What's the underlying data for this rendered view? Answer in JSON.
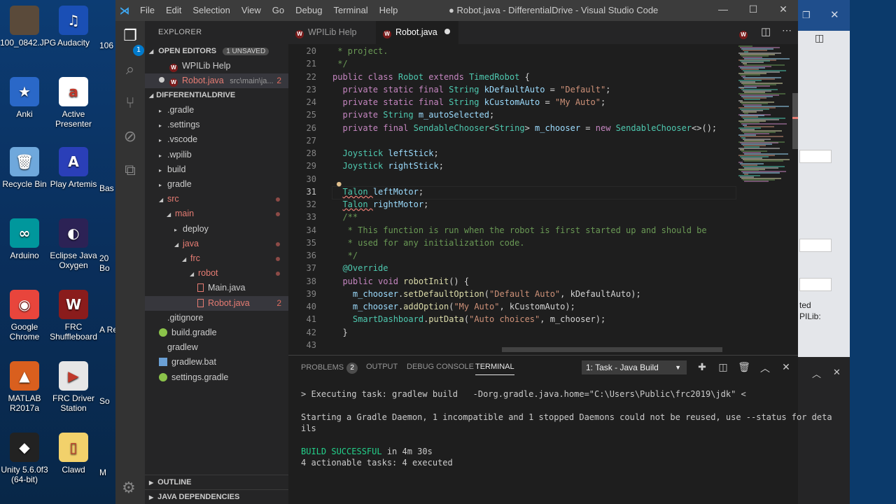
{
  "desktop": {
    "icons": [
      {
        "label": "100_0842.JPG",
        "color": "#5a4a3a",
        "glyph": ""
      },
      {
        "label": "Audacity",
        "color": "#1a4fb5",
        "glyph": "♫"
      },
      {
        "label": "Anki",
        "color": "#2a68c8",
        "glyph": "★"
      },
      {
        "label": "Active Presenter",
        "color": "#ffffff",
        "glyph": "a"
      },
      {
        "label": "Recycle Bin",
        "color": "#6fa8dc",
        "glyph": "🗑"
      },
      {
        "label": "Play Artemis",
        "color": "#2a3fb8",
        "glyph": "A"
      },
      {
        "label": "Arduino",
        "color": "#00979c",
        "glyph": "∞"
      },
      {
        "label": "Eclipse Java Oxygen",
        "color": "#2c2255",
        "glyph": "◐"
      },
      {
        "label": "Google Chrome",
        "color": "#e8453c",
        "glyph": "◉"
      },
      {
        "label": "FRC Shuffleboard",
        "color": "#8a1c1c",
        "glyph": "W"
      },
      {
        "label": "MATLAB R2017a",
        "color": "#d95f1e",
        "glyph": "▲"
      },
      {
        "label": "FRC Driver Station",
        "color": "#e6e6e6",
        "glyph": "▶"
      },
      {
        "label": "Unity 5.6.0f3 (64-bit)",
        "color": "#222222",
        "glyph": "◆"
      },
      {
        "label": "Clawd",
        "color": "#f2d16b",
        "glyph": "▯"
      }
    ],
    "partial_labels": [
      "106",
      "Bas",
      "20 Bo",
      "A Re",
      "So",
      "M"
    ]
  },
  "window": {
    "title": "● Robot.java - DifferentialDrive - Visual Studio Code",
    "menu": [
      "File",
      "Edit",
      "Selection",
      "View",
      "Go",
      "Debug",
      "Terminal",
      "Help"
    ]
  },
  "activity": {
    "scm_badge": "1",
    "icons": [
      "files-icon",
      "search-icon",
      "source-control-icon",
      "debug-icon",
      "extensions-icon"
    ]
  },
  "explorer": {
    "title": "EXPLORER",
    "open_editors_label": "OPEN EDITORS",
    "unsaved_badge": "1 UNSAVED",
    "open_editors": [
      {
        "name": "WPILib Help",
        "path": "",
        "count": ""
      },
      {
        "name": "Robot.java",
        "path": "src\\main\\ja...",
        "count": "2"
      }
    ],
    "project_label": "DIFFERENTIALDRIVE",
    "tree": [
      {
        "label": ".gradle",
        "depth": 0,
        "arrow": "▸",
        "kind": "folder",
        "red": false,
        "count": "",
        "dot": false
      },
      {
        "label": ".settings",
        "depth": 0,
        "arrow": "▸",
        "kind": "folder",
        "red": false,
        "count": "",
        "dot": false
      },
      {
        "label": ".vscode",
        "depth": 0,
        "arrow": "▸",
        "kind": "folder",
        "red": false,
        "count": "",
        "dot": false
      },
      {
        "label": ".wpilib",
        "depth": 0,
        "arrow": "▸",
        "kind": "folder",
        "red": false,
        "count": "",
        "dot": false
      },
      {
        "label": "build",
        "depth": 0,
        "arrow": "▸",
        "kind": "folder",
        "red": false,
        "count": "",
        "dot": false
      },
      {
        "label": "gradle",
        "depth": 0,
        "arrow": "▸",
        "kind": "folder",
        "red": false,
        "count": "",
        "dot": false
      },
      {
        "label": "src",
        "depth": 0,
        "arrow": "◢",
        "kind": "folder",
        "red": true,
        "count": "",
        "dot": true
      },
      {
        "label": "main",
        "depth": 1,
        "arrow": "◢",
        "kind": "folder",
        "red": true,
        "count": "",
        "dot": true
      },
      {
        "label": "deploy",
        "depth": 2,
        "arrow": "▸",
        "kind": "folder",
        "red": false,
        "count": "",
        "dot": false
      },
      {
        "label": "java",
        "depth": 2,
        "arrow": "◢",
        "kind": "folder",
        "red": true,
        "count": "",
        "dot": true
      },
      {
        "label": "frc",
        "depth": 3,
        "arrow": "◢",
        "kind": "folder",
        "red": true,
        "count": "",
        "dot": true
      },
      {
        "label": "robot",
        "depth": 4,
        "arrow": "◢",
        "kind": "folder",
        "red": true,
        "count": "",
        "dot": true
      },
      {
        "label": "Main.java",
        "depth": 5,
        "arrow": "",
        "kind": "java",
        "red": false,
        "count": "",
        "dot": false
      },
      {
        "label": "Robot.java",
        "depth": 5,
        "arrow": "",
        "kind": "java",
        "red": true,
        "count": "2",
        "dot": false
      },
      {
        "label": ".gitignore",
        "depth": 0,
        "arrow": "",
        "kind": "text",
        "red": false,
        "count": "",
        "dot": false
      },
      {
        "label": "build.gradle",
        "depth": 0,
        "arrow": "",
        "kind": "gradle",
        "red": false,
        "count": "",
        "dot": false
      },
      {
        "label": "gradlew",
        "depth": 0,
        "arrow": "",
        "kind": "text",
        "red": false,
        "count": "",
        "dot": false
      },
      {
        "label": "gradlew.bat",
        "depth": 0,
        "arrow": "",
        "kind": "bat",
        "red": false,
        "count": "",
        "dot": false
      },
      {
        "label": "settings.gradle",
        "depth": 0,
        "arrow": "",
        "kind": "gradle",
        "red": false,
        "count": "",
        "dot": false
      }
    ],
    "outline_label": "OUTLINE",
    "java_deps_label": "JAVA DEPENDENCIES"
  },
  "tabs": [
    {
      "label": "WPILib Help",
      "active": false
    },
    {
      "label": "Robot.java",
      "active": true
    }
  ],
  "editor": {
    "current_line": 31,
    "lines": [
      {
        "n": 20,
        "t": [
          [
            "cm",
            " * project."
          ]
        ]
      },
      {
        "n": 21,
        "t": [
          [
            "cm",
            " */"
          ]
        ]
      },
      {
        "n": 22,
        "t": [
          [
            "kw",
            "public class "
          ],
          [
            "ty",
            "Robot "
          ],
          [
            "kw",
            "extends "
          ],
          [
            "ty",
            "TimedRobot "
          ],
          [
            "",
            "{"
          ]
        ]
      },
      {
        "n": 23,
        "t": [
          [
            "",
            "  "
          ],
          [
            "kw",
            "private static final "
          ],
          [
            "ty",
            "String "
          ],
          [
            "vr",
            "kDefaultAuto"
          ],
          [
            "",
            " = "
          ],
          [
            "st",
            "\"Default\""
          ],
          [
            "",
            ";"
          ]
        ]
      },
      {
        "n": 24,
        "t": [
          [
            "",
            "  "
          ],
          [
            "kw",
            "private static final "
          ],
          [
            "ty",
            "String "
          ],
          [
            "vr",
            "kCustomAuto"
          ],
          [
            "",
            " = "
          ],
          [
            "st",
            "\"My Auto\""
          ],
          [
            "",
            ";"
          ]
        ]
      },
      {
        "n": 25,
        "t": [
          [
            "",
            "  "
          ],
          [
            "kw",
            "private "
          ],
          [
            "ty",
            "String "
          ],
          [
            "vr",
            "m_autoSelected"
          ],
          [
            "",
            ";"
          ]
        ]
      },
      {
        "n": 26,
        "t": [
          [
            "",
            "  "
          ],
          [
            "kw",
            "private final "
          ],
          [
            "ty",
            "SendableChooser"
          ],
          [
            "",
            "<"
          ],
          [
            "ty",
            "String"
          ],
          [
            "",
            "> "
          ],
          [
            "vr",
            "m_chooser"
          ],
          [
            "",
            " = "
          ],
          [
            "kw",
            "new "
          ],
          [
            "ty",
            "SendableChooser"
          ],
          [
            "",
            "<>();"
          ]
        ]
      },
      {
        "n": 27,
        "t": [
          [
            "",
            ""
          ]
        ]
      },
      {
        "n": 28,
        "t": [
          [
            "",
            "  "
          ],
          [
            "ty",
            "Joystick "
          ],
          [
            "vr",
            "leftStick"
          ],
          [
            "",
            ";"
          ]
        ]
      },
      {
        "n": 29,
        "t": [
          [
            "",
            "  "
          ],
          [
            "ty",
            "Joystick "
          ],
          [
            "vr",
            "rightStick"
          ],
          [
            "",
            ";"
          ]
        ]
      },
      {
        "n": 30,
        "t": [
          [
            "",
            ""
          ]
        ]
      },
      {
        "n": 31,
        "t": [
          [
            "",
            "  "
          ],
          [
            "ty",
            "Talon "
          ],
          [
            "vr",
            "leftMotor"
          ],
          [
            "",
            ";"
          ]
        ]
      },
      {
        "n": 32,
        "t": [
          [
            "",
            "  "
          ],
          [
            "ty",
            "Talon "
          ],
          [
            "vr",
            "rightMotor"
          ],
          [
            "",
            ";"
          ]
        ]
      },
      {
        "n": 33,
        "t": [
          [
            "",
            "  "
          ],
          [
            "cm",
            "/**"
          ]
        ]
      },
      {
        "n": 34,
        "t": [
          [
            "cm",
            "   * This function is run when the robot is first started up and should be"
          ]
        ]
      },
      {
        "n": 35,
        "t": [
          [
            "cm",
            "   * used for any initialization code."
          ]
        ]
      },
      {
        "n": 36,
        "t": [
          [
            "cm",
            "   */"
          ]
        ]
      },
      {
        "n": 37,
        "t": [
          [
            "",
            "  "
          ],
          [
            "an",
            "@Override"
          ]
        ]
      },
      {
        "n": 38,
        "t": [
          [
            "",
            "  "
          ],
          [
            "kw",
            "public void "
          ],
          [
            "fn",
            "robotInit"
          ],
          [
            "",
            "() {"
          ]
        ]
      },
      {
        "n": 39,
        "t": [
          [
            "",
            "    "
          ],
          [
            "vr",
            "m_chooser"
          ],
          [
            "",
            "."
          ],
          [
            "fn",
            "setDefaultOption"
          ],
          [
            "",
            "("
          ],
          [
            "st",
            "\"Default Auto\""
          ],
          [
            "",
            ", kDefaultAuto);"
          ]
        ]
      },
      {
        "n": 40,
        "t": [
          [
            "",
            "    "
          ],
          [
            "vr",
            "m_chooser"
          ],
          [
            "",
            "."
          ],
          [
            "fn",
            "addOption"
          ],
          [
            "",
            "("
          ],
          [
            "st",
            "\"My Auto\""
          ],
          [
            "",
            ", kCustomAuto);"
          ]
        ]
      },
      {
        "n": 41,
        "t": [
          [
            "",
            "    "
          ],
          [
            "ty",
            "SmartDashboard"
          ],
          [
            "",
            "."
          ],
          [
            "fn",
            "putData"
          ],
          [
            "",
            "("
          ],
          [
            "st",
            "\"Auto choices\""
          ],
          [
            "",
            ", m_chooser);"
          ]
        ]
      },
      {
        "n": 42,
        "t": [
          [
            "",
            "  }"
          ]
        ]
      },
      {
        "n": 43,
        "t": [
          [
            "",
            ""
          ]
        ]
      }
    ]
  },
  "panel": {
    "tabs": [
      {
        "label": "PROBLEMS",
        "badge": "2",
        "active": false
      },
      {
        "label": "OUTPUT",
        "badge": "",
        "active": false
      },
      {
        "label": "DEBUG CONSOLE",
        "badge": "",
        "active": false
      },
      {
        "label": "TERMINAL",
        "badge": "",
        "active": true
      }
    ],
    "task_select": "1: Task - Java Build",
    "terminal": [
      {
        "text": "> Executing task: gradlew build   -Dorg.gradle.java.home=\"C:\\Users\\Public\\frc2019\\jdk\" <",
        "cls": ""
      },
      {
        "text": "",
        "cls": ""
      },
      {
        "text": "Starting a Gradle Daemon, 1 incompatible and 1 stopped Daemons could not be reused, use --status for deta",
        "cls": ""
      },
      {
        "text": "ils",
        "cls": ""
      },
      {
        "text": "",
        "cls": ""
      },
      {
        "text": "BUILD SUCCESSFUL in 4m 30s",
        "cls": "green"
      },
      {
        "text": "4 actionable tasks: 4 executed",
        "cls": ""
      }
    ]
  },
  "background_window": {
    "text_lines": [
      "ted",
      "PILib:"
    ]
  },
  "colors": {
    "accent": "#007acc",
    "error": "#e67c73",
    "success": "#23d18b"
  }
}
